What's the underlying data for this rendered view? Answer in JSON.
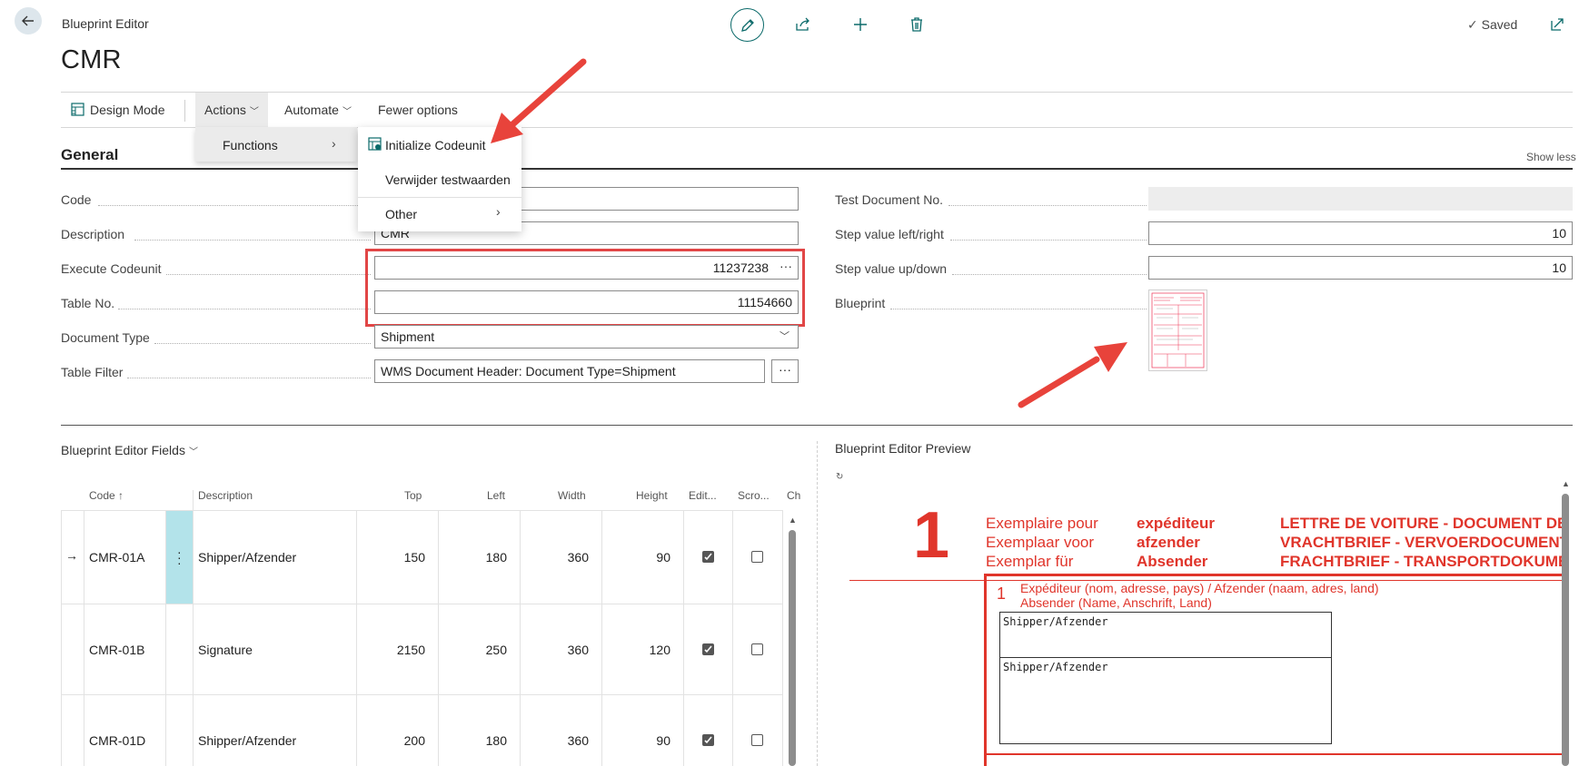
{
  "header": {
    "breadcrumb": "Blueprint Editor",
    "title": "CMR",
    "saved_label": "Saved"
  },
  "actionbar": {
    "design_mode": "Design Mode",
    "actions": "Actions",
    "automate": "Automate",
    "fewer_options": "Fewer options"
  },
  "menu": {
    "functions": "Functions",
    "items": [
      "Initialize Codeunit",
      "Verwijder testwaarden",
      "Other"
    ]
  },
  "general": {
    "title": "General",
    "show_less": "Show less",
    "left_fields": [
      {
        "label": "Code",
        "value": ""
      },
      {
        "label": "Description",
        "value": "CMR"
      },
      {
        "label": "Execute Codeunit",
        "value": "11237238"
      },
      {
        "label": "Table No.",
        "value": "11154660"
      },
      {
        "label": "Document Type",
        "value": "Shipment"
      },
      {
        "label": "Table Filter",
        "value": "WMS Document Header: Document Type=Shipment"
      }
    ],
    "right_fields": [
      {
        "label": "Test Document No.",
        "value": ""
      },
      {
        "label": "Step value left/right",
        "value": "10"
      },
      {
        "label": "Step value up/down",
        "value": "10"
      },
      {
        "label": "Blueprint",
        "value": ""
      }
    ]
  },
  "fields_list": {
    "title": "Blueprint Editor Fields",
    "columns": [
      "Code",
      "Description",
      "Top",
      "Left",
      "Width",
      "Height",
      "Edit...",
      "Scro...",
      "Ch"
    ],
    "rows": [
      {
        "code": "CMR-01A",
        "description": "Shipper/Afzender",
        "top": "150",
        "left": "180",
        "width": "360",
        "height": "90",
        "editable": true,
        "scroll": false
      },
      {
        "code": "CMR-01B",
        "description": "Signature",
        "top": "2150",
        "left": "250",
        "width": "360",
        "height": "120",
        "editable": true,
        "scroll": false
      },
      {
        "code": "CMR-01D",
        "description": "Shipper/Afzender",
        "top": "200",
        "left": "180",
        "width": "360",
        "height": "90",
        "editable": true,
        "scroll": false
      }
    ]
  },
  "preview": {
    "title": "Blueprint Editor Preview",
    "doc_number": "1",
    "exemplaire": [
      "Exemplaire pour",
      "Exemplaar voor",
      "Exemplar für"
    ],
    "recipient": [
      "expéditeur",
      "afzender",
      "Absender"
    ],
    "doc_title": [
      "LETTRE DE VOITURE - DOCUMENT DE",
      "VRACHTBRIEF - VERVOERDOCUMENT",
      "FRACHTBRIEF - TRANSPORTDOKUMEN"
    ],
    "box_number": "1",
    "box_label_1": "Expéditeur (nom, adresse, pays) / Afzender (naam, adres, land)",
    "box_label_2": "Absender (Name, Anschrift, Land)",
    "field_1": "Shipper/Afzender",
    "field_2": "Shipper/Afzender"
  },
  "colors": {
    "accent": "#0b6a6a",
    "highlight_red": "#e14646",
    "arrow_red": "#e8433b",
    "selected_cell": "#b3e3ea"
  }
}
